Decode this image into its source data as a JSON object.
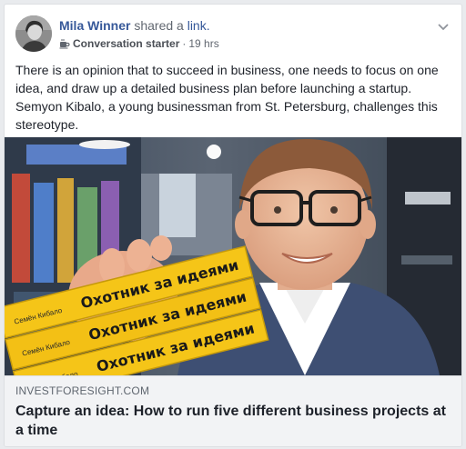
{
  "post": {
    "author_name": "Mila Winner",
    "action_text": "shared a",
    "action_link": "link.",
    "badge": "Conversation starter",
    "separator": "·",
    "timestamp": "19 hrs",
    "body_text": "There is an opinion that to succeed in business, one needs to focus on one idea, and draw up a detailed business plan before launching a startup. Semyon Kibalo, a young businessman from St. Petersburg, challenges this stereotype."
  },
  "link_preview": {
    "domain": "INVESTFORESIGHT.COM",
    "title": "Capture an idea: How to run five different business projects at a time",
    "book_title": "Охотник за идеями",
    "book_author": "Семён Кибало"
  },
  "icons": {
    "badge_icon": "coffee-cup-icon",
    "menu_icon": "chevron-down-icon"
  },
  "colors": {
    "link_blue": "#365899",
    "caption_bg": "#f2f3f5",
    "book_yellow": "#f5c518"
  }
}
